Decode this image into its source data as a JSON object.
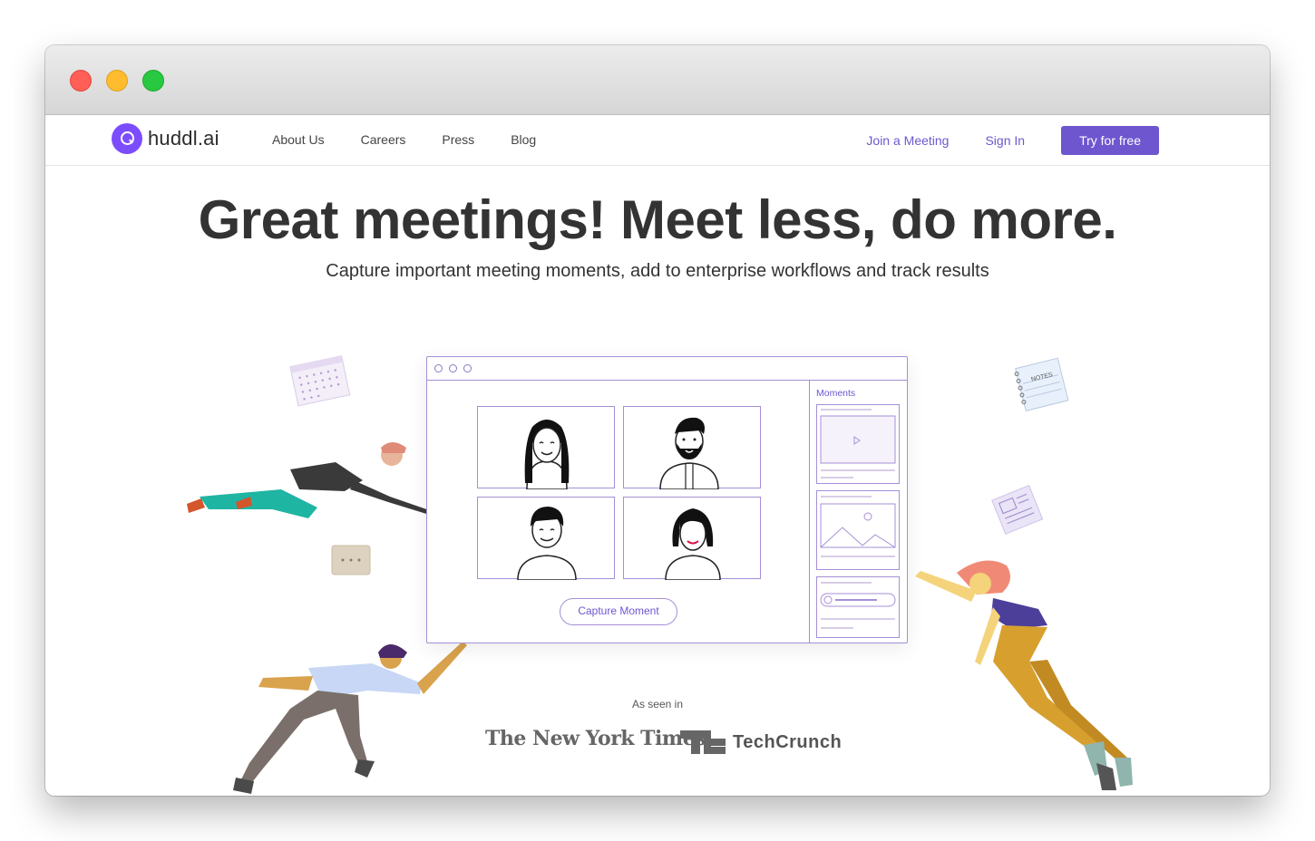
{
  "brand": {
    "name": "huddl.ai",
    "accent": "#6e56cf",
    "logo_color": "#7c4dff"
  },
  "nav": {
    "links": [
      "About Us",
      "Careers",
      "Press",
      "Blog"
    ],
    "join_label": "Join a Meeting",
    "signin_label": "Sign In",
    "cta_label": "Try for free"
  },
  "hero": {
    "title": "Great meetings! Meet less, do more.",
    "subtitle": "Capture important meeting moments, add to enterprise workflows and track results"
  },
  "mockup": {
    "moments_label": "Moments",
    "capture_label": "Capture Moment"
  },
  "notepad_label": "NOTES",
  "press": {
    "label": "As seen in",
    "logos": [
      "The New York Times",
      "TechCrunch"
    ]
  }
}
